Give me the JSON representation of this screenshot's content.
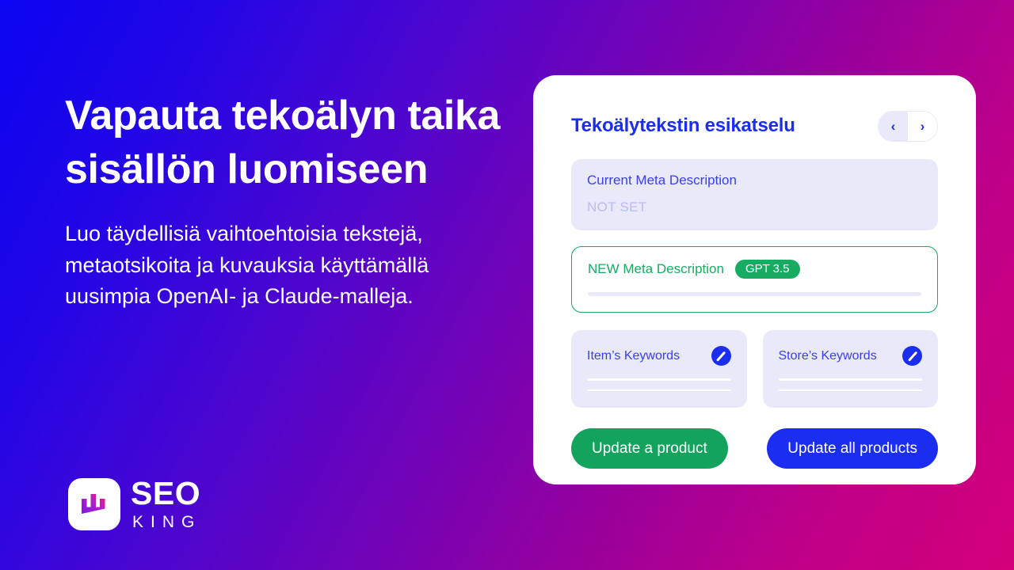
{
  "hero": {
    "headline": "Vapauta tekoälyn taika sisällön luomiseen",
    "subcopy": "Luo täydellisiä vaihtoehtoisia tekstejä, metaotsikoita ja kuvauksia käyttämällä uusimpia OpenAI- ja Claude-malleja."
  },
  "logo": {
    "mark_icon": "bar-chart-crown-icon",
    "primary": "SEO",
    "secondary": "KING"
  },
  "card": {
    "title": "Tekoälytekstin esikatselu",
    "pager": {
      "prev_icon": "chevron-left-icon",
      "prev_label": "‹",
      "next_icon": "chevron-right-icon",
      "next_label": "›"
    },
    "current_meta": {
      "label": "Current Meta Description",
      "value": "NOT SET"
    },
    "new_meta": {
      "label": "NEW Meta Description",
      "badge": "GPT 3.5"
    },
    "keywords": [
      {
        "label": "Item’s Keywords",
        "edit_icon": "edit-pencil-icon"
      },
      {
        "label": "Store’s Keywords",
        "edit_icon": "edit-pencil-icon"
      }
    ],
    "actions": {
      "update_one": "Update a product",
      "update_all": "Update all products"
    }
  },
  "colors": {
    "brand_blue": "#1a2df0",
    "brand_green": "#18ab62",
    "lavender": "#e9e9fa",
    "muted_text": "#b9bcf0",
    "gradient_start": "#0a04f0",
    "gradient_mid": "#9c0099",
    "gradient_end": "#d4007a"
  }
}
